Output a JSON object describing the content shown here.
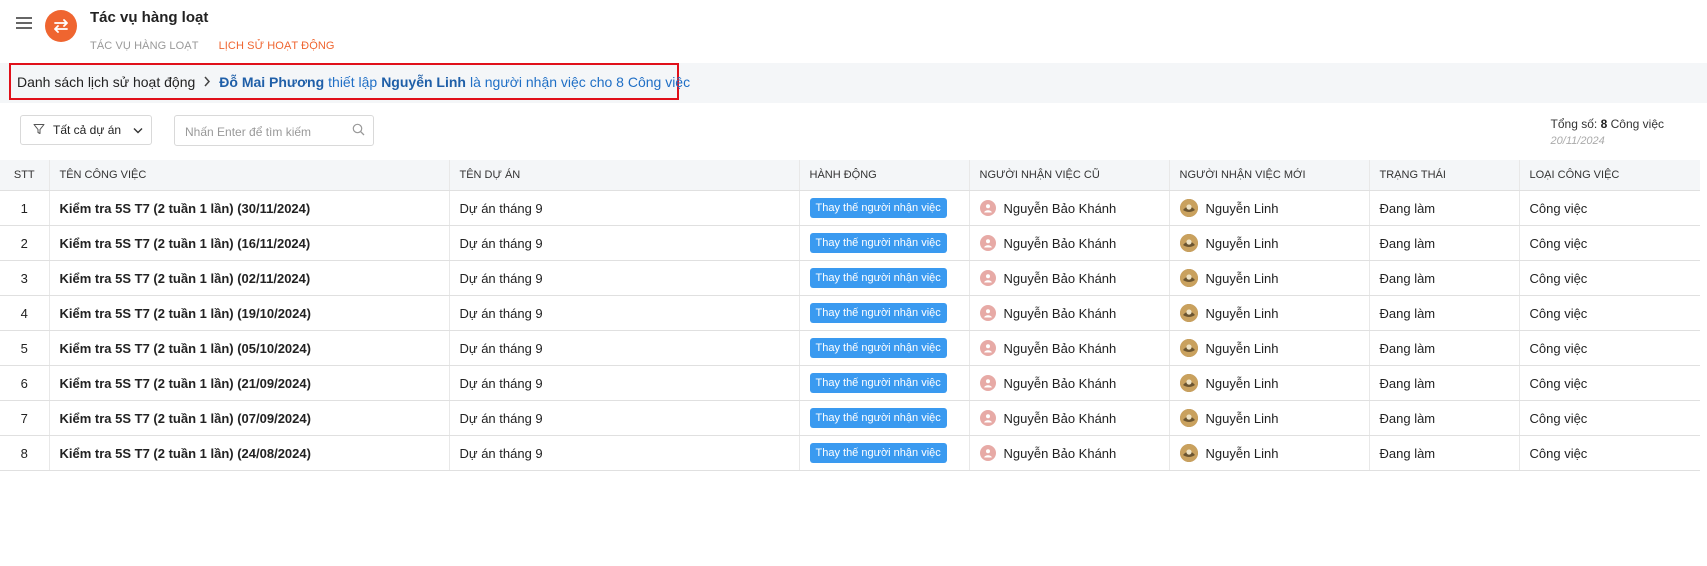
{
  "header": {
    "app_title": "Tác vụ hàng loạt",
    "tabs": [
      {
        "label": "TÁC VỤ HÀNG LOẠT",
        "active": false
      },
      {
        "label": "LỊCH SỬ HOẠT ĐỘNG",
        "active": true
      }
    ],
    "accent_color": "#ef6530"
  },
  "breadcrumb": {
    "root": "Danh sách lịch sử hoạt động",
    "actor": "Đỗ Mai Phương",
    "action_text": "thiết lập",
    "assignee": "Nguyễn Linh",
    "suffix": "là người nhận việc cho 8 Công việc",
    "highlight_color": "#e0101a"
  },
  "toolbar": {
    "filter_label": "Tất cả dự án",
    "search_placeholder": "Nhấn Enter để tìm kiếm"
  },
  "summary": {
    "label": "Tổng số:",
    "count": "8",
    "unit": "Công việc",
    "date": "20/11/2024"
  },
  "table": {
    "headers": {
      "stt": "STT",
      "task": "TÊN CÔNG VIỆC",
      "project": "TÊN DỰ ÁN",
      "action": "HÀNH ĐỘNG",
      "old_assignee": "NGƯỜI NHẬN VIỆC CŨ",
      "new_assignee": "NGƯỜI NHẬN VIỆC MỚI",
      "status": "TRẠNG THÁI",
      "type": "LOẠI CÔNG VIỆC"
    },
    "rows": [
      {
        "stt": "1",
        "task": "Kiểm tra 5S T7 (2 tuần 1 lần) (30/11/2024)",
        "project": "Dự án tháng 9",
        "action": "Thay thế người nhận việc",
        "old_assignee": "Nguyễn Bảo Khánh",
        "new_assignee": "Nguyễn Linh",
        "status": "Đang làm",
        "type": "Công việc"
      },
      {
        "stt": "2",
        "task": "Kiểm tra 5S T7 (2 tuần 1 lần) (16/11/2024)",
        "project": "Dự án tháng 9",
        "action": "Thay thế người nhận việc",
        "old_assignee": "Nguyễn Bảo Khánh",
        "new_assignee": "Nguyễn Linh",
        "status": "Đang làm",
        "type": "Công việc"
      },
      {
        "stt": "3",
        "task": "Kiểm tra 5S T7 (2 tuần 1 lần) (02/11/2024)",
        "project": "Dự án tháng 9",
        "action": "Thay thế người nhận việc",
        "old_assignee": "Nguyễn Bảo Khánh",
        "new_assignee": "Nguyễn Linh",
        "status": "Đang làm",
        "type": "Công việc"
      },
      {
        "stt": "4",
        "task": "Kiểm tra 5S T7 (2 tuần 1 lần) (19/10/2024)",
        "project": "Dự án tháng 9",
        "action": "Thay thế người nhận việc",
        "old_assignee": "Nguyễn Bảo Khánh",
        "new_assignee": "Nguyễn Linh",
        "status": "Đang làm",
        "type": "Công việc"
      },
      {
        "stt": "5",
        "task": "Kiểm tra 5S T7 (2 tuần 1 lần) (05/10/2024)",
        "project": "Dự án tháng 9",
        "action": "Thay thế người nhận việc",
        "old_assignee": "Nguyễn Bảo Khánh",
        "new_assignee": "Nguyễn Linh",
        "status": "Đang làm",
        "type": "Công việc"
      },
      {
        "stt": "6",
        "task": "Kiểm tra 5S T7 (2 tuần 1 lần) (21/09/2024)",
        "project": "Dự án tháng 9",
        "action": "Thay thế người nhận việc",
        "old_assignee": "Nguyễn Bảo Khánh",
        "new_assignee": "Nguyễn Linh",
        "status": "Đang làm",
        "type": "Công việc"
      },
      {
        "stt": "7",
        "task": "Kiểm tra 5S T7 (2 tuần 1 lần) (07/09/2024)",
        "project": "Dự án tháng 9",
        "action": "Thay thế người nhận việc",
        "old_assignee": "Nguyễn Bảo Khánh",
        "new_assignee": "Nguyễn Linh",
        "status": "Đang làm",
        "type": "Công việc"
      },
      {
        "stt": "8",
        "task": "Kiểm tra 5S T7 (2 tuần 1 lần) (24/08/2024)",
        "project": "Dự án tháng 9",
        "action": "Thay thế người nhận việc",
        "old_assignee": "Nguyễn Bảo Khánh",
        "new_assignee": "Nguyễn Linh",
        "status": "Đang làm",
        "type": "Công việc"
      }
    ],
    "action_badge_color": "#3a9af0"
  }
}
